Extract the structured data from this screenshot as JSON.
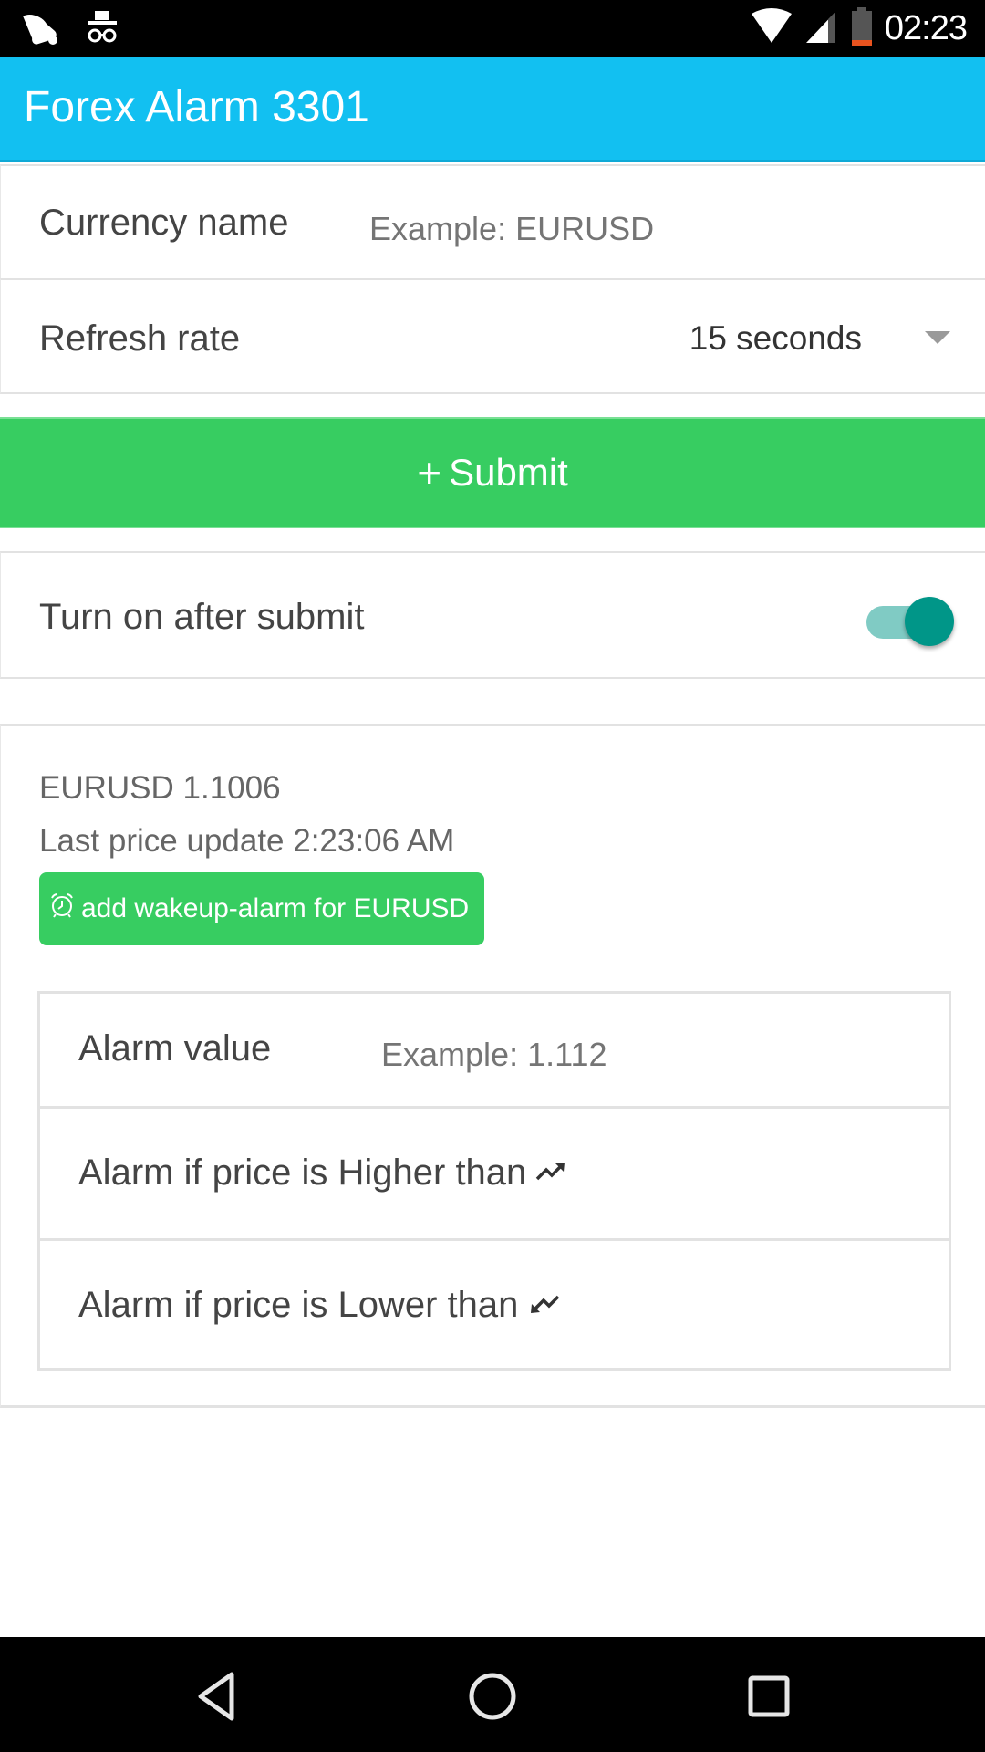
{
  "status_bar": {
    "time": "02:23",
    "left_icons": [
      "notification-bell-icon",
      "incognito-icon"
    ],
    "right_icons": [
      "wifi-icon",
      "signal-icon",
      "battery-icon"
    ]
  },
  "app_bar": {
    "title": "Forex Alarm 3301"
  },
  "form": {
    "currency": {
      "label": "Currency name",
      "value": "",
      "placeholder": "Example: EURUSD"
    },
    "refresh": {
      "label": "Refresh rate",
      "selected": "15 seconds"
    },
    "submit": {
      "icon": "+",
      "label": "Submit"
    },
    "turn_on": {
      "label": "Turn on after submit",
      "enabled": true
    }
  },
  "quote_card": {
    "price_line": "EURUSD 1.1006",
    "last_update": "Last price update 2:23:06 AM",
    "wakeup_button": "add wakeup-alarm for EURUSD",
    "alarm": {
      "value_label": "Alarm value",
      "value": "",
      "value_placeholder": "Example: 1.112",
      "higher_label": "Alarm if price is Higher than",
      "lower_label": "Alarm if price is Lower than"
    }
  },
  "nav_bar": {
    "buttons": [
      "back",
      "home",
      "recents"
    ]
  },
  "colors": {
    "app_bar": "#12c0f1",
    "primary_green": "#37cd61",
    "toggle_on": "#009688"
  }
}
